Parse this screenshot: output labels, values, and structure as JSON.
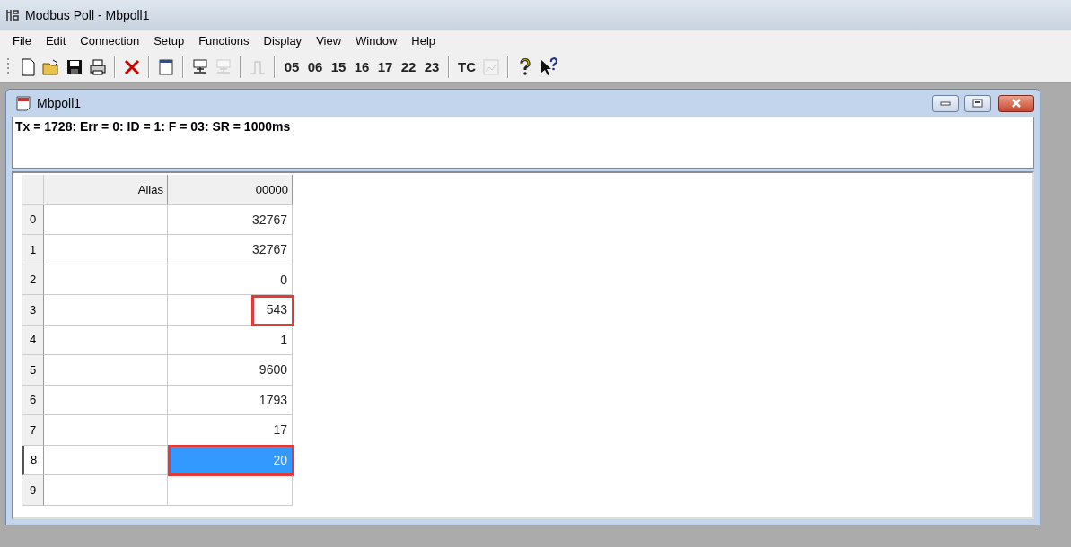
{
  "window": {
    "title": "Modbus Poll - Mbpoll1"
  },
  "menu": [
    "File",
    "Edit",
    "Connection",
    "Setup",
    "Functions",
    "Display",
    "View",
    "Window",
    "Help"
  ],
  "toolbar": [
    [
      {
        "kind": "icon",
        "disabled": false
      },
      {
        "kind": "icon",
        "disabled": false
      },
      {
        "kind": "icon",
        "disabled": false
      },
      {
        "kind": "icon",
        "disabled": false
      }
    ],
    [
      {
        "kind": "icon",
        "disabled": false
      }
    ],
    [
      {
        "kind": "icon",
        "disabled": false
      }
    ],
    [
      {
        "kind": "icon",
        "disabled": false
      },
      {
        "kind": "icon",
        "disabled": true
      }
    ],
    [
      {
        "kind": "icon",
        "disabled": true
      }
    ],
    [
      {
        "kind": "text",
        "label": "05"
      },
      {
        "kind": "text",
        "label": "06"
      },
      {
        "kind": "text",
        "label": "15"
      },
      {
        "kind": "text",
        "label": "16"
      },
      {
        "kind": "text",
        "label": "17"
      },
      {
        "kind": "text",
        "label": "22"
      },
      {
        "kind": "text",
        "label": "23"
      }
    ],
    [
      {
        "kind": "text",
        "label": "TC"
      },
      {
        "kind": "icon",
        "disabled": true
      }
    ],
    [
      {
        "kind": "icon",
        "disabled": false
      },
      {
        "kind": "icon",
        "disabled": false
      }
    ]
  ],
  "child_window": {
    "title": "Mbpoll1",
    "status": "Tx = 1728: Err = 0: ID = 1: F = 03: SR = 1000ms",
    "table": {
      "columns": [
        "Alias",
        "00000"
      ],
      "rows": [
        {
          "index": "0",
          "value": "32767",
          "selected": false,
          "highlighted": false
        },
        {
          "index": "1",
          "value": "32767",
          "selected": false,
          "highlighted": false
        },
        {
          "index": "2",
          "value": "0",
          "selected": false,
          "highlighted": false
        },
        {
          "index": "3",
          "value": "543",
          "selected": false,
          "highlighted": true
        },
        {
          "index": "4",
          "value": "1",
          "selected": false,
          "highlighted": false
        },
        {
          "index": "5",
          "value": "9600",
          "selected": false,
          "highlighted": false
        },
        {
          "index": "6",
          "value": "1793",
          "selected": false,
          "highlighted": false
        },
        {
          "index": "7",
          "value": "17",
          "selected": false,
          "highlighted": false
        },
        {
          "index": "8",
          "value": "20",
          "selected": true,
          "highlighted": true
        },
        {
          "index": "9",
          "selected": false,
          "highlighted": false
        }
      ]
    }
  }
}
